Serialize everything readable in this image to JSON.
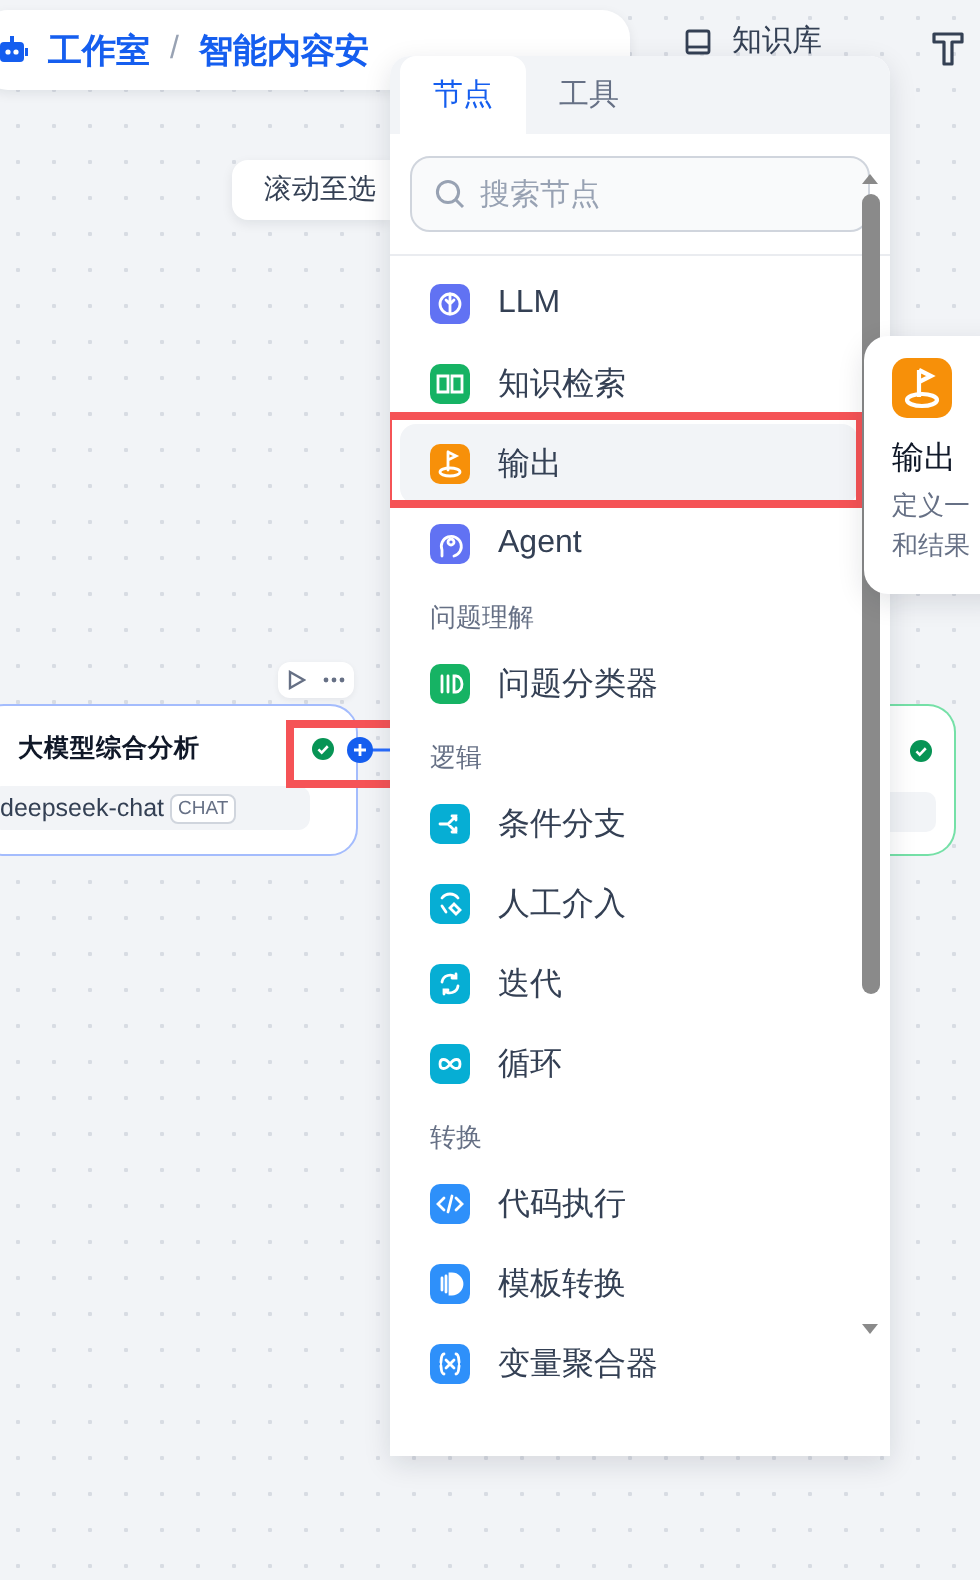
{
  "header": {
    "title": "工作室",
    "separator": "/",
    "app_name": "智能内容安",
    "actions": [
      {
        "label": "知识库"
      }
    ]
  },
  "scroll_button": {
    "label": "滚动至选"
  },
  "node": {
    "title": "大模型综合分析",
    "model": "deepseek-chat",
    "tag": "CHAT",
    "highlighted": true
  },
  "picker": {
    "tabs": [
      {
        "label": "节点",
        "selected": true
      },
      {
        "label": "工具",
        "selected": false
      }
    ],
    "search": {
      "placeholder": "搜索节点"
    },
    "groups": [
      {
        "items": [
          {
            "kind": "llm",
            "label": "LLM",
            "color": "#6172f3",
            "highlighted": false
          },
          {
            "kind": "knowledge",
            "label": "知识检索",
            "color": "#16b364",
            "highlighted": false
          },
          {
            "kind": "output",
            "label": "输出",
            "color": "#f79009",
            "highlighted": true
          },
          {
            "kind": "agent",
            "label": "Agent",
            "color": "#6172f3",
            "highlighted": false
          }
        ]
      },
      {
        "title": "问题理解",
        "items": [
          {
            "kind": "classifier",
            "label": "问题分类器",
            "color": "#16b364",
            "highlighted": false
          }
        ]
      },
      {
        "title": "逻辑",
        "items": [
          {
            "kind": "branch",
            "label": "条件分支",
            "color": "#06aed4",
            "highlighted": false
          },
          {
            "kind": "human",
            "label": "人工介入",
            "color": "#06aed4",
            "highlighted": false
          },
          {
            "kind": "iteration",
            "label": "迭代",
            "color": "#06aed4",
            "highlighted": false
          },
          {
            "kind": "loop",
            "label": "循环",
            "color": "#06aed4",
            "highlighted": false
          }
        ]
      },
      {
        "title": "转换",
        "items": [
          {
            "kind": "code",
            "label": "代码执行",
            "color": "#2e90fa",
            "highlighted": false
          },
          {
            "kind": "template",
            "label": "模板转换",
            "color": "#2e90fa",
            "highlighted": false
          },
          {
            "kind": "aggregator",
            "label": "变量聚合器",
            "color": "#2e90fa",
            "highlighted": false
          }
        ]
      }
    ]
  },
  "tooltip": {
    "kind": "output",
    "color": "#f79009",
    "title": "输出",
    "description_lines": [
      "定义一",
      "和结果"
    ]
  }
}
